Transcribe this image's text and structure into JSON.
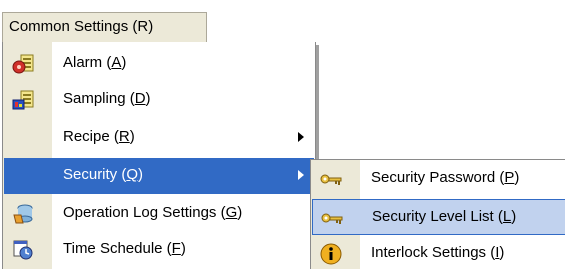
{
  "menubar": {
    "label": "Common Settings (R)"
  },
  "primary_menu": {
    "items": [
      {
        "label_pre": "Alarm (",
        "key": "A",
        "label_post": ")",
        "icon": "alarm-icon"
      },
      {
        "label_pre": "Sampling (",
        "key": "D",
        "label_post": ")",
        "icon": "sampling-icon"
      },
      {
        "label_pre": "Recipe (",
        "key": "R",
        "label_post": ")",
        "icon": ""
      },
      {
        "label_pre": "Security (",
        "key": "Q",
        "label_post": ")",
        "icon": ""
      },
      {
        "label_pre": "Operation Log Settings (",
        "key": "G",
        "label_post": ")",
        "icon": "operation-log-icon"
      },
      {
        "label_pre": "Time Schedule (",
        "key": "F",
        "label_post": ")",
        "icon": "time-schedule-icon"
      }
    ]
  },
  "security_submenu": {
    "items": [
      {
        "label_pre": "Security Password (",
        "key": "P",
        "label_post": ")",
        "icon": "key-icon"
      },
      {
        "label_pre": "Security Level List (",
        "key": "L",
        "label_post": ")",
        "icon": "key-icon"
      },
      {
        "label_pre": "Interlock Settings (",
        "key": "I",
        "label_post": ")",
        "icon": "info-icon"
      }
    ]
  },
  "colors": {
    "highlight": "#316ac5",
    "submenu_hover": "#c1d2ee",
    "menu_gutter": "#ece9d8"
  }
}
